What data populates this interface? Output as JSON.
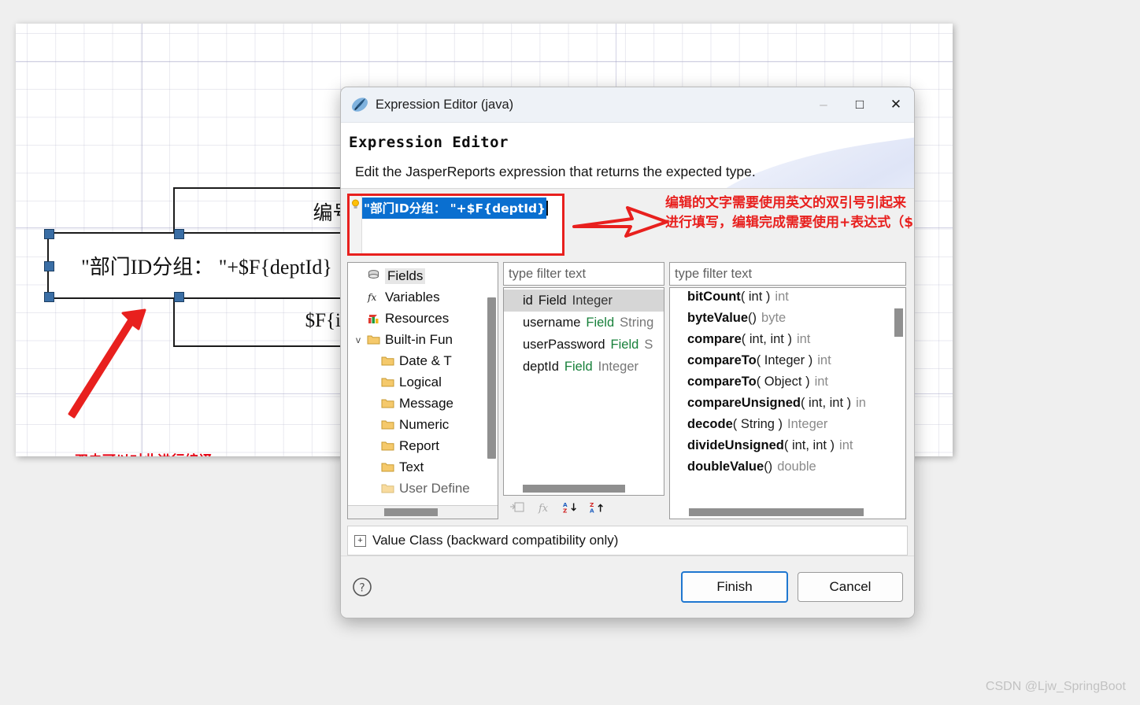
{
  "canvas": {
    "title_band_text": "编号",
    "selected_field_text": "\"部门ID分组：  \"+$F{deptId}",
    "id_band_text": "$F{id}",
    "annotation_bottom": "双击可以对此进行编译"
  },
  "dialog": {
    "icon": "jasperreports-icon",
    "title": "Expression Editor (java)",
    "minimize": "–",
    "maximize": "□",
    "close": "✕",
    "header_title": "Expression Editor",
    "header_subtitle": "Edit the JasperReports expression that returns the expected type.",
    "expression": {
      "lightbulb": "lightbulb-icon",
      "text": "\"部门ID分组：  \"+$F{deptId}"
    },
    "annotation_right_line1": "编辑的文字需要使用英文的双引号引起来",
    "annotation_right_line2": "进行填写，编辑完成需要使用+表达式（${}）",
    "tree": [
      {
        "label": "Fields",
        "icon": "database-icon",
        "depth": 1,
        "selected": true,
        "twisty": ""
      },
      {
        "label": "Variables",
        "icon": "fx-icon",
        "depth": 1,
        "selected": false,
        "twisty": ""
      },
      {
        "label": "Resources",
        "icon": "resources-icon",
        "depth": 1,
        "selected": false,
        "twisty": ""
      },
      {
        "label": "Built-in Fun",
        "icon": "folder-icon",
        "depth": 1,
        "selected": false,
        "twisty": "v"
      },
      {
        "label": "Date & T",
        "icon": "folder-icon",
        "depth": 2,
        "selected": false,
        "twisty": ""
      },
      {
        "label": "Logical",
        "icon": "folder-icon",
        "depth": 2,
        "selected": false,
        "twisty": ""
      },
      {
        "label": "Message",
        "icon": "folder-icon",
        "depth": 2,
        "selected": false,
        "twisty": ""
      },
      {
        "label": "Numeric",
        "icon": "folder-icon",
        "depth": 2,
        "selected": false,
        "twisty": ""
      },
      {
        "label": "Report",
        "icon": "folder-icon",
        "depth": 2,
        "selected": false,
        "twisty": ""
      },
      {
        "label": "Text",
        "icon": "folder-icon",
        "depth": 2,
        "selected": false,
        "twisty": ""
      },
      {
        "label": "User Define",
        "icon": "folder-icon",
        "depth": 2,
        "selected": false,
        "twisty": ""
      }
    ],
    "fields_filter_placeholder": "type filter text",
    "fields": [
      {
        "name": "id",
        "tag": "Field",
        "type": "Integer",
        "selected": true
      },
      {
        "name": "username",
        "tag": "Field",
        "type": "String",
        "selected": false
      },
      {
        "name": "userPassword",
        "tag": "Field",
        "type": "S",
        "selected": false
      },
      {
        "name": "deptId",
        "tag": "Field",
        "type": "Integer",
        "selected": false
      }
    ],
    "fields_tools": [
      "insert-field-icon",
      "insert-function-icon",
      "sort-az-icon",
      "sort-za-icon"
    ],
    "methods_filter_placeholder": "type filter text",
    "methods": [
      {
        "name": "bitCount",
        "args": "( int )",
        "ret": "int"
      },
      {
        "name": "byteValue",
        "args": "()",
        "ret": "byte"
      },
      {
        "name": "compare",
        "args": "( int, int )",
        "ret": "int"
      },
      {
        "name": "compareTo",
        "args": "( Integer )",
        "ret": "int"
      },
      {
        "name": "compareTo",
        "args": "( Object )",
        "ret": "int"
      },
      {
        "name": "compareUnsigned",
        "args": "( int, int )",
        "ret": "in"
      },
      {
        "name": "decode",
        "args": "( String )",
        "ret": "Integer"
      },
      {
        "name": "divideUnsigned",
        "args": "( int, int )",
        "ret": "int"
      },
      {
        "name": "doubleValue",
        "args": "()",
        "ret": "double"
      }
    ],
    "value_class_label": "Value Class (backward compatibility only)",
    "value_class_expander": "+",
    "help_icon": "help-question-icon",
    "finish_label": "Finish",
    "cancel_label": "Cancel"
  },
  "watermark": "CSDN @Ljw_SpringBoot",
  "colors": {
    "selection_blue": "#0a6fd0",
    "annotation_red": "#e8201e",
    "accent_blue": "#1f77d0",
    "handle_blue": "#3a6ea5"
  }
}
